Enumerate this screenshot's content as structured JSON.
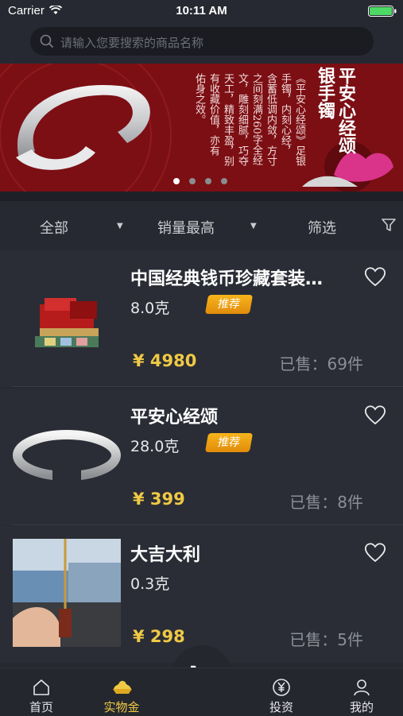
{
  "status_bar": {
    "carrier": "Carrier",
    "time": "10:11 AM"
  },
  "search": {
    "placeholder": "请输入您要搜索的商品名称"
  },
  "banner": {
    "title_lines": [
      "平安心经颂",
      "银手镯"
    ],
    "text_lines": [
      "《平安心经颂》足银",
      "手镯，内刻心经，",
      "含蓄低调内敛，方寸",
      "之间刻满260字全经",
      "文，雕刻细腻，巧夺",
      "天工，精致丰盈，别",
      "有收藏价值，亦有",
      "佑身之效。"
    ],
    "dots": 4,
    "active_dot": 0,
    "colors": {
      "background": "#7c0f14",
      "silver": "#d9dadc"
    }
  },
  "filters": [
    {
      "label": "全部",
      "dropdown": true
    },
    {
      "label": "销量最高",
      "dropdown": true
    },
    {
      "label": "筛选",
      "icon": "funnel-icon"
    }
  ],
  "products": [
    {
      "name": "中国经典钱币珍藏套装…",
      "weight": "8.0克",
      "badge": "推荐",
      "price": "¥ 4980",
      "sold": "已售：69件",
      "image": "coin-collection-box"
    },
    {
      "name": "平安心经颂",
      "weight": "28.0克",
      "badge": "推荐",
      "price": "¥ 399",
      "sold": "已售：8件",
      "image": "silver-bangle"
    },
    {
      "name": "大吉大利",
      "weight": "0.3克",
      "badge": "",
      "price": "¥ 298",
      "sold": "已售：5件",
      "image": "car-pendant"
    }
  ],
  "tabbar": {
    "items": [
      {
        "label": "首页",
        "icon": "home-icon"
      },
      {
        "label": "实物金",
        "icon": "gold-ingot-icon",
        "active": true
      },
      {
        "label": "",
        "icon": "cart-icon"
      },
      {
        "label": "投资",
        "icon": "yen-coin-icon"
      },
      {
        "label": "我的",
        "icon": "user-icon"
      }
    ]
  },
  "colors": {
    "accent_gold": "#f0c945",
    "badge_orange": "#f0a016",
    "background": "#262931"
  }
}
